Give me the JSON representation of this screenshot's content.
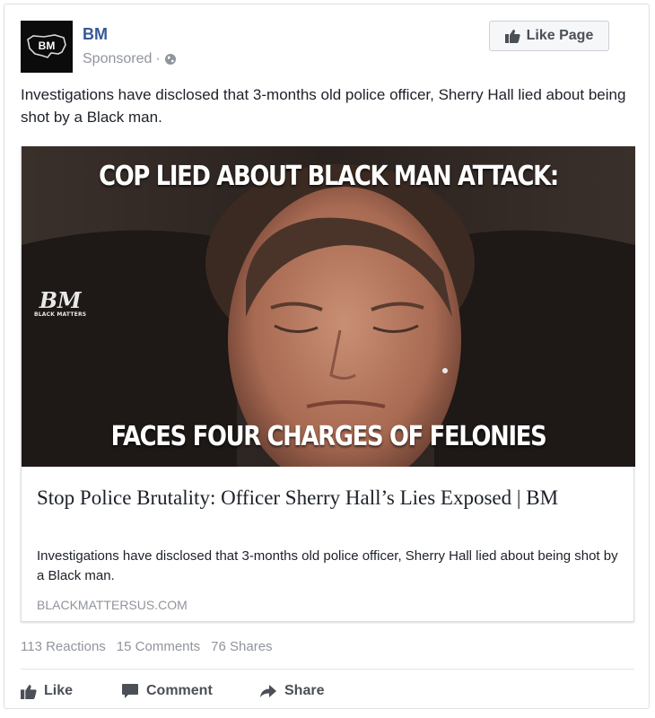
{
  "post": {
    "page_name": "BM",
    "sponsored_label": "Sponsored",
    "separator": "·",
    "like_page_label": "Like Page",
    "avatar_label": "BM",
    "text": "Investigations have disclosed that 3-months old police officer, Sherry Hall lied about being shot by a Black man."
  },
  "link": {
    "image_top_caption": "COP LIED ABOUT BLACK MAN ATTACK:",
    "image_bottom_caption": "FACES FOUR CHARGES OF FELONIES",
    "watermark_main": "BM",
    "watermark_sub": "BLACK MATTERS",
    "title": "Stop Police Brutality: Officer Sherry Hall’s Lies Exposed | BM",
    "description": "Investigations have disclosed that 3-months old police officer, Sherry Hall lied about being shot by a Black man.",
    "domain": "BLACKMATTERSUS.COM"
  },
  "stats": {
    "reactions": "113 Reactions",
    "comments": "15 Comments",
    "shares": "76 Shares"
  },
  "actions": {
    "like": "Like",
    "comment": "Comment",
    "share": "Share"
  },
  "colors": {
    "link_blue": "#365899",
    "meta_gray": "#90949c",
    "action_gray": "#4b4f56"
  },
  "icons": {
    "globe": "globe-icon",
    "thumbs_up": "thumbs-up-icon",
    "comment": "comment-icon",
    "share": "share-arrow-icon"
  }
}
